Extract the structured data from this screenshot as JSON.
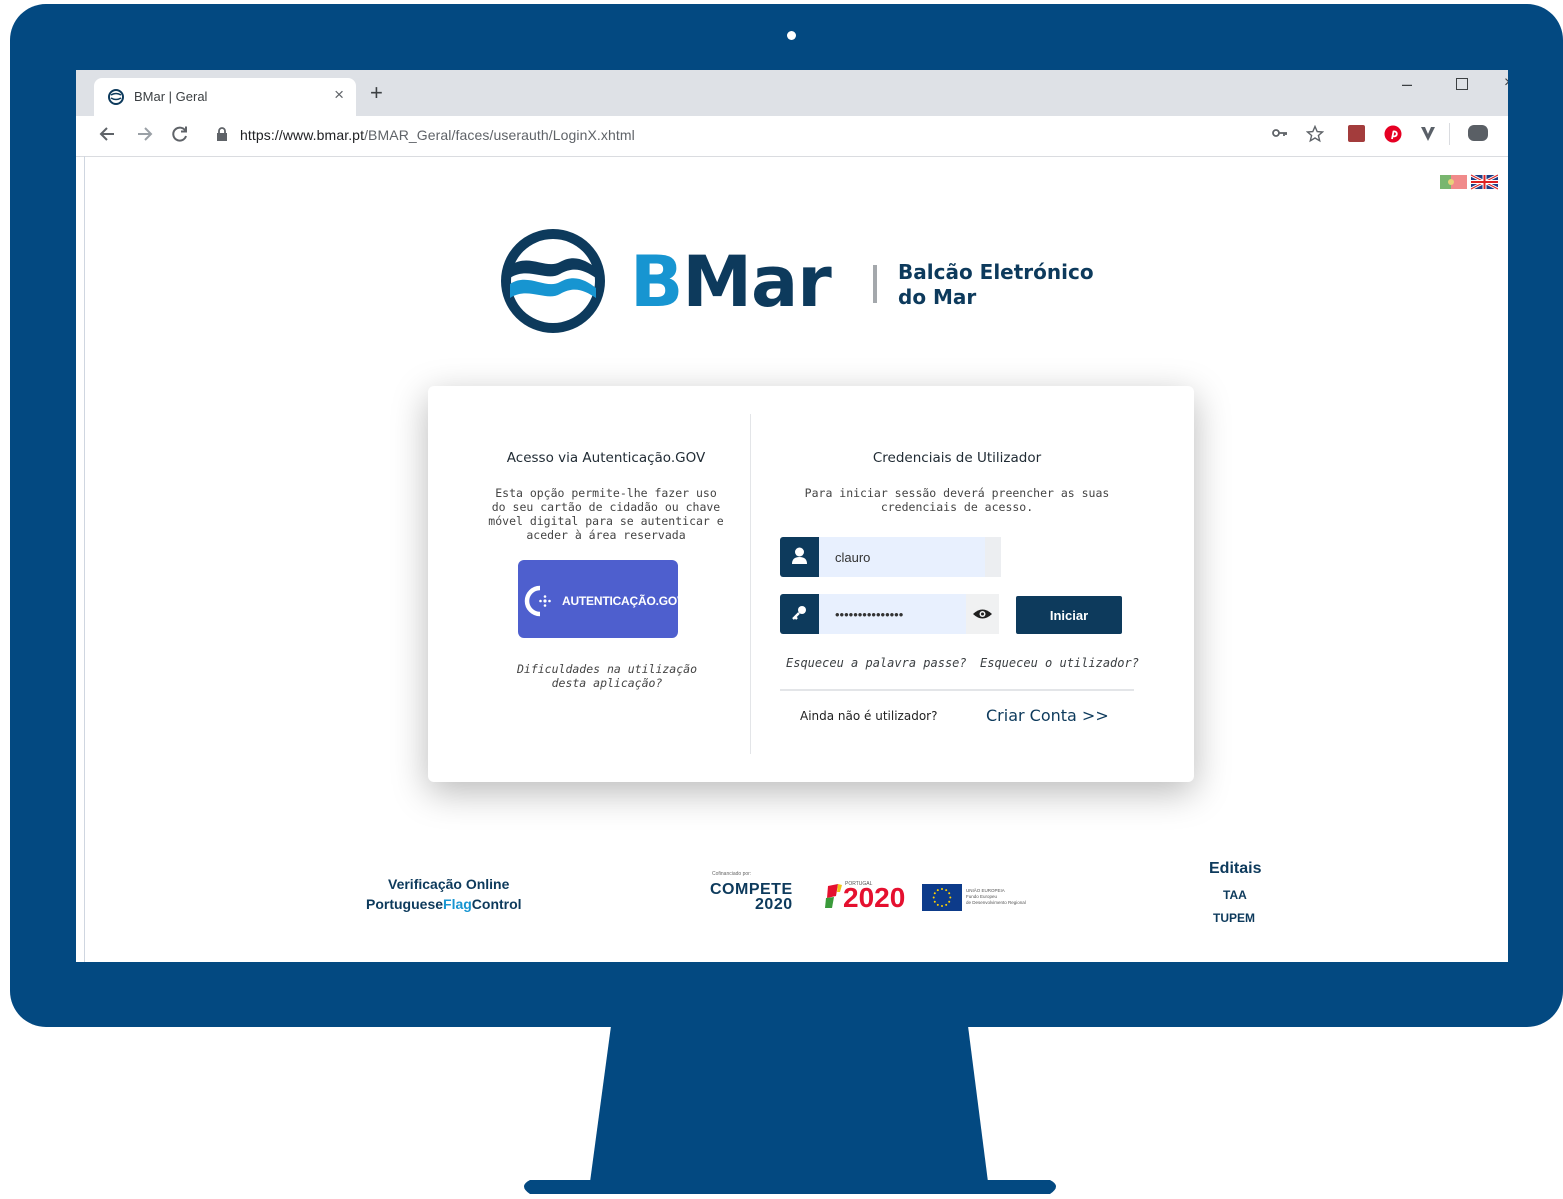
{
  "browser": {
    "tab_title": "BMar | Geral",
    "tab_close": "×",
    "new_tab": "+",
    "url_host": "https://www.bmar.pt",
    "url_path": "/BMAR_Geral/faces/userauth/LoginX.xhtml",
    "window_min": "–",
    "window_close": "×"
  },
  "header": {
    "brand_b": "B",
    "brand_rest": "Mar",
    "subtitle_line1": "Balcão Eletrónico",
    "subtitle_line2": "do Mar"
  },
  "autgov_panel": {
    "title": "Acesso via Autenticação.GOV",
    "description": "Esta opção permite-lhe fazer uso do seu cartão de cidadão ou chave móvel digital para se autenticar e aceder à área reservada",
    "button_label": "AUTENTICAÇÃO.GOV",
    "help_link": "Dificuldades na utilização desta aplicação?"
  },
  "credentials_panel": {
    "title": "Credenciais de Utilizador",
    "description": "Para iniciar sessão deverá preencher as suas credenciais de acesso.",
    "username_value": "clauro",
    "password_value": "•••••••••••••••",
    "submit_label": "Iniciar",
    "forgot_password": "Esqueceu a palavra passe?",
    "forgot_username": "Esqueceu o utilizador?",
    "not_user_text": "Ainda não é utilizador?",
    "create_account": "Criar Conta >>"
  },
  "footer": {
    "verification_title": "Verificação Online",
    "pfc_a": "Portuguese",
    "pfc_b": "Flag",
    "pfc_c": "Control",
    "cofinanced": "Cofinanciado por:",
    "compete": "COMPETE",
    "compete_year": "2020",
    "portugal_label": "PORTUGAL",
    "portugal_2020": "2020",
    "eu_text_1": "UNIÃO EUROPEIA",
    "eu_text_2": "Fundo Europeu",
    "eu_text_3": "de Desenvolvimento Regional",
    "editais": "Editais",
    "taa": "TAA",
    "tupem": "TUPEM"
  },
  "colors": {
    "monitor": "#034981",
    "brand_dark": "#0d3a5c",
    "brand_light": "#1795d1",
    "autgov": "#4e5fce"
  }
}
